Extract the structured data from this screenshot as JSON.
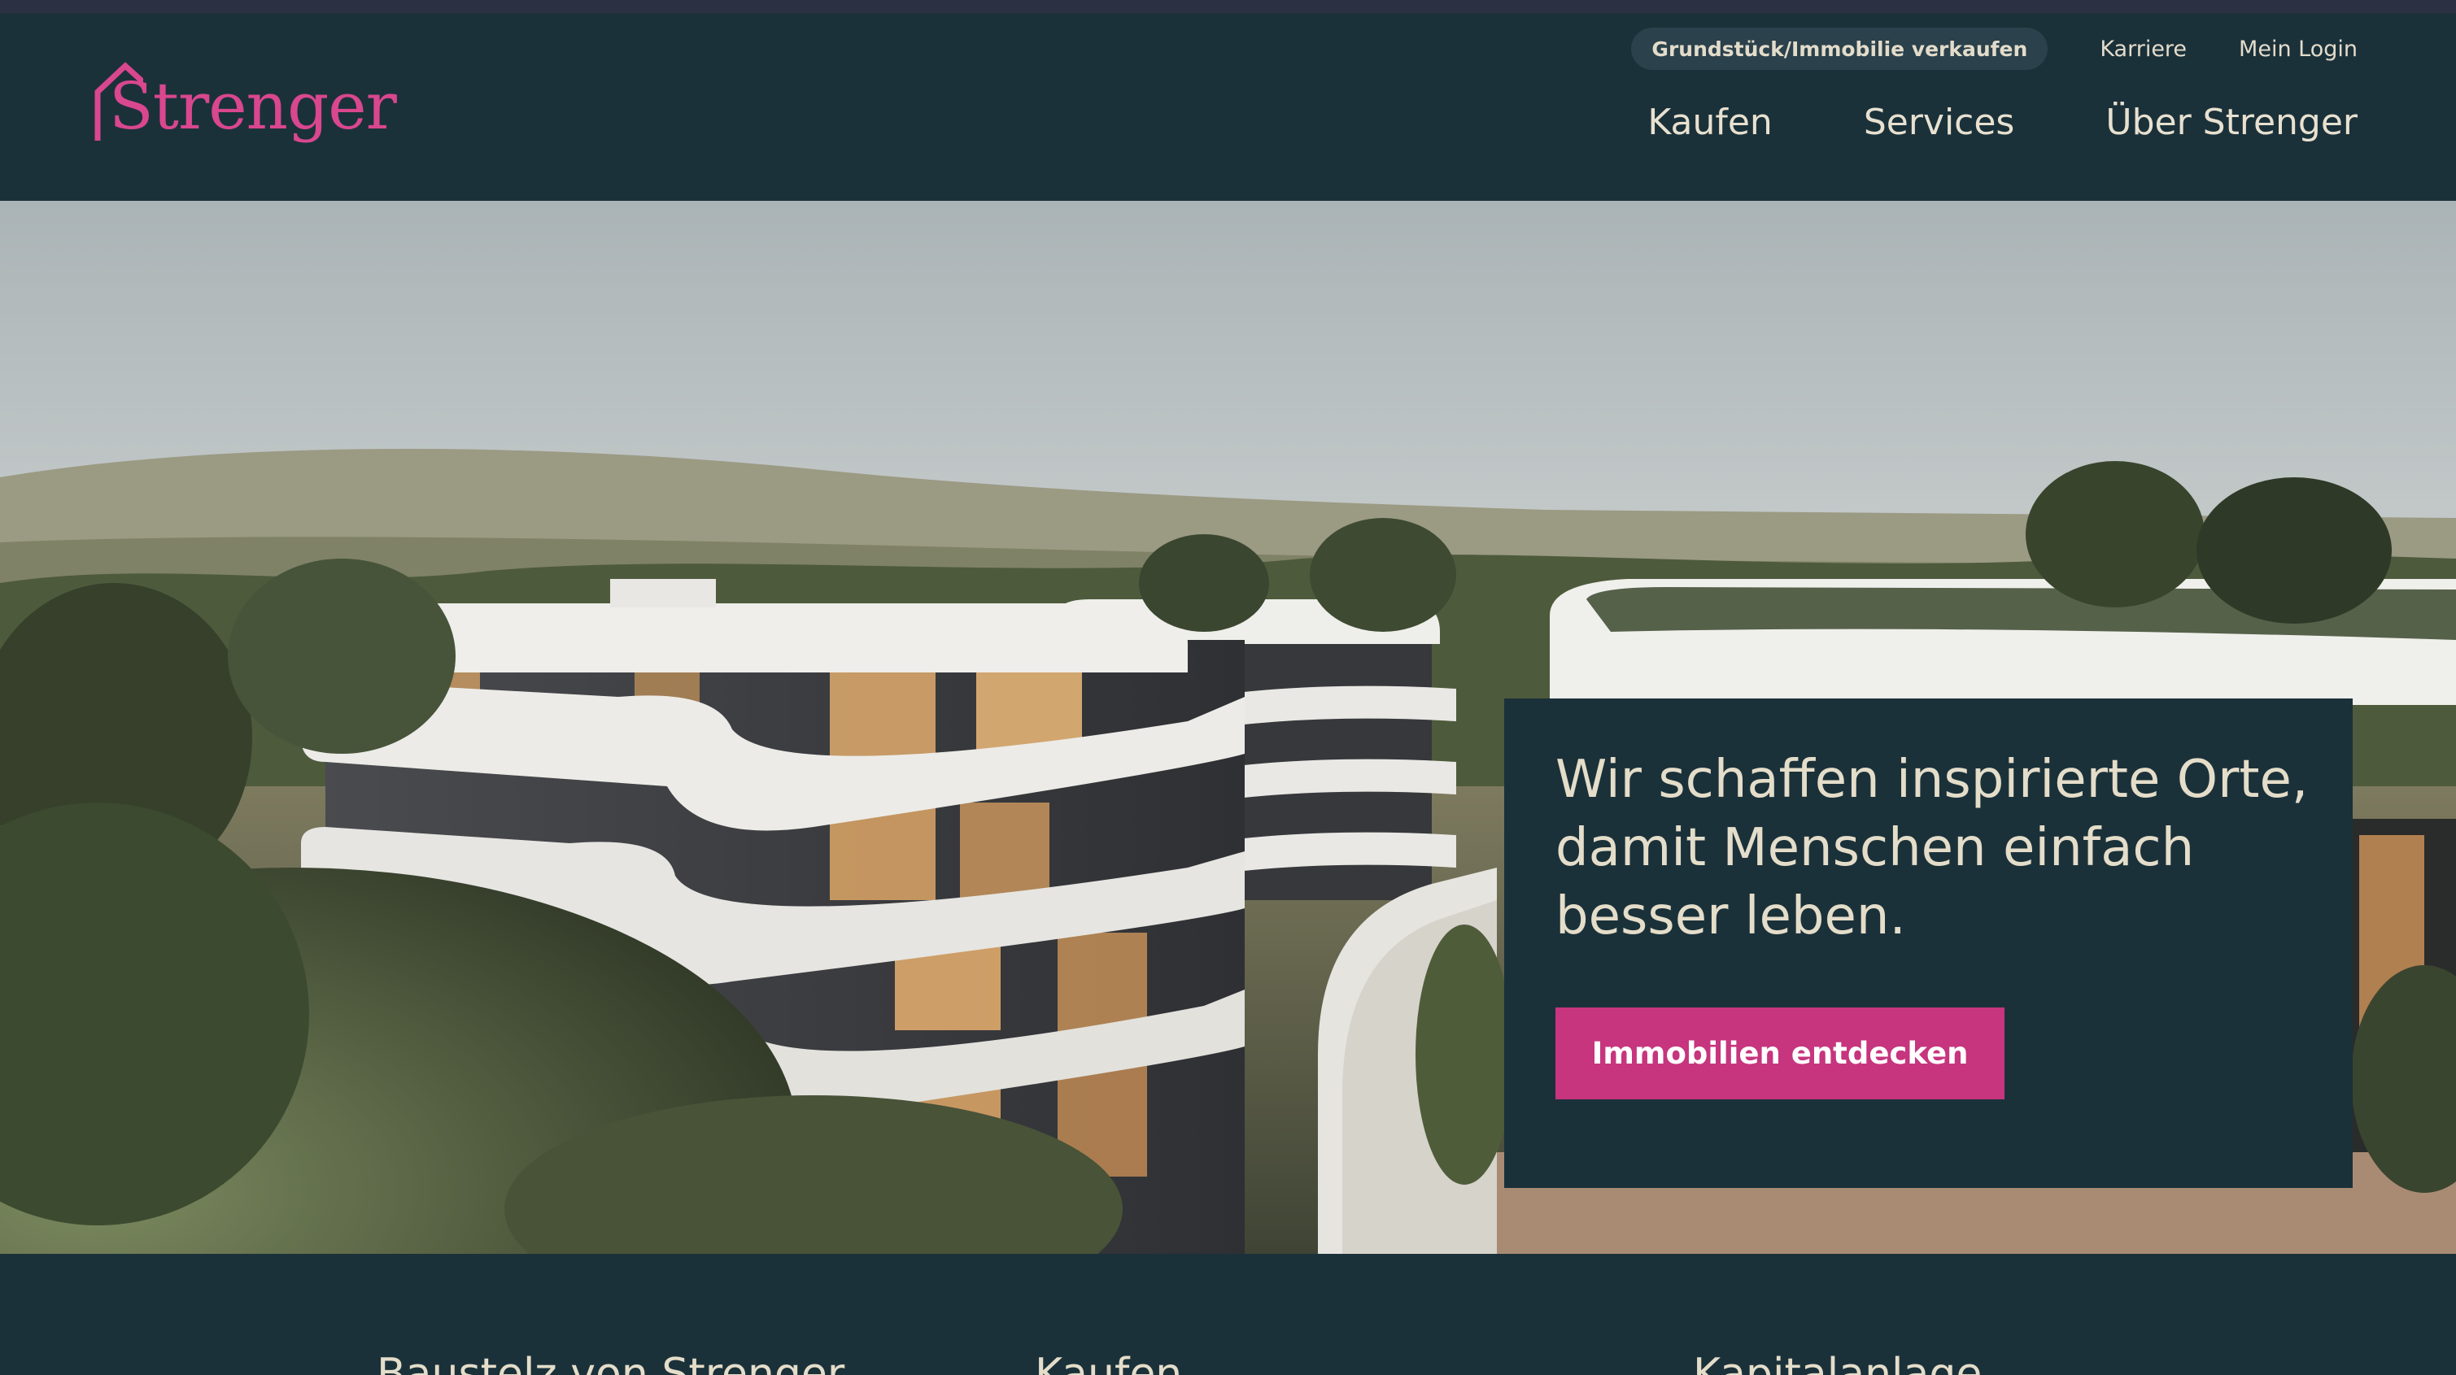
{
  "brand": {
    "logo_text": "Strenger",
    "accent": "#d9478f"
  },
  "util_nav": {
    "sell_label": "Grundstück/Immobilie verkaufen",
    "career_label": "Karriere",
    "login_label": "Mein Login"
  },
  "main_nav": {
    "items": [
      {
        "label": "Kaufen"
      },
      {
        "label": "Services"
      },
      {
        "label": "Über Strenger"
      }
    ]
  },
  "hero": {
    "heading": "Wir schaffen inspirierte Orte, damit Menschen einfach besser leben.",
    "cta_label": "Immobilien entdecken",
    "cta_color": "#c6357e"
  },
  "teaser": {
    "columns": [
      {
        "label": "Baustelz von Strenger"
      },
      {
        "label": "Kaufen"
      },
      {
        "label": "Kapitalanlage"
      }
    ]
  },
  "colors": {
    "header_bg": "#1b313a",
    "strip_bg": "#2b3043",
    "text": "#e4ddc9"
  }
}
